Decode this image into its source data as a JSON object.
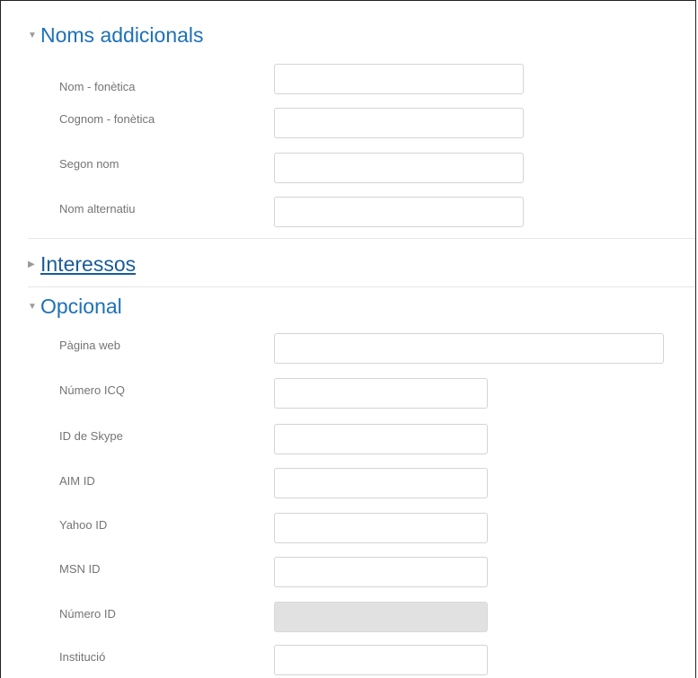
{
  "sections": {
    "noms_addicionals": {
      "title": "Noms addicionals",
      "fields": [
        {
          "label": "Nom - fonètica",
          "value": "",
          "placeholder": ""
        },
        {
          "label": "Cognom - fonètica",
          "value": "",
          "placeholder": ""
        },
        {
          "label": "Segon nom",
          "value": "",
          "placeholder": ""
        },
        {
          "label": "Nom alternatiu",
          "value": "",
          "placeholder": ""
        }
      ]
    },
    "interessos": {
      "title": "Interessos"
    },
    "opcional": {
      "title": "Opcional",
      "fields": [
        {
          "label": "Pàgina web",
          "value": "",
          "placeholder": ""
        },
        {
          "label": "Número ICQ",
          "value": "",
          "placeholder": ""
        },
        {
          "label": "ID de Skype",
          "value": "",
          "placeholder": ""
        },
        {
          "label": "AIM ID",
          "value": "",
          "placeholder": ""
        },
        {
          "label": "Yahoo ID",
          "value": "",
          "placeholder": ""
        },
        {
          "label": "MSN ID",
          "value": "",
          "placeholder": ""
        },
        {
          "label": "Número ID",
          "value": "",
          "placeholder": ""
        },
        {
          "label": "Institució",
          "value": "",
          "placeholder": ""
        }
      ]
    }
  },
  "icons": {
    "expanded": "caret-down-icon",
    "collapsed": "caret-right-icon"
  },
  "colors": {
    "section_title": "#1d71b8",
    "label": "#747474",
    "field_border": "#d4d4d4",
    "disabled_field": "#e1e1e1"
  }
}
